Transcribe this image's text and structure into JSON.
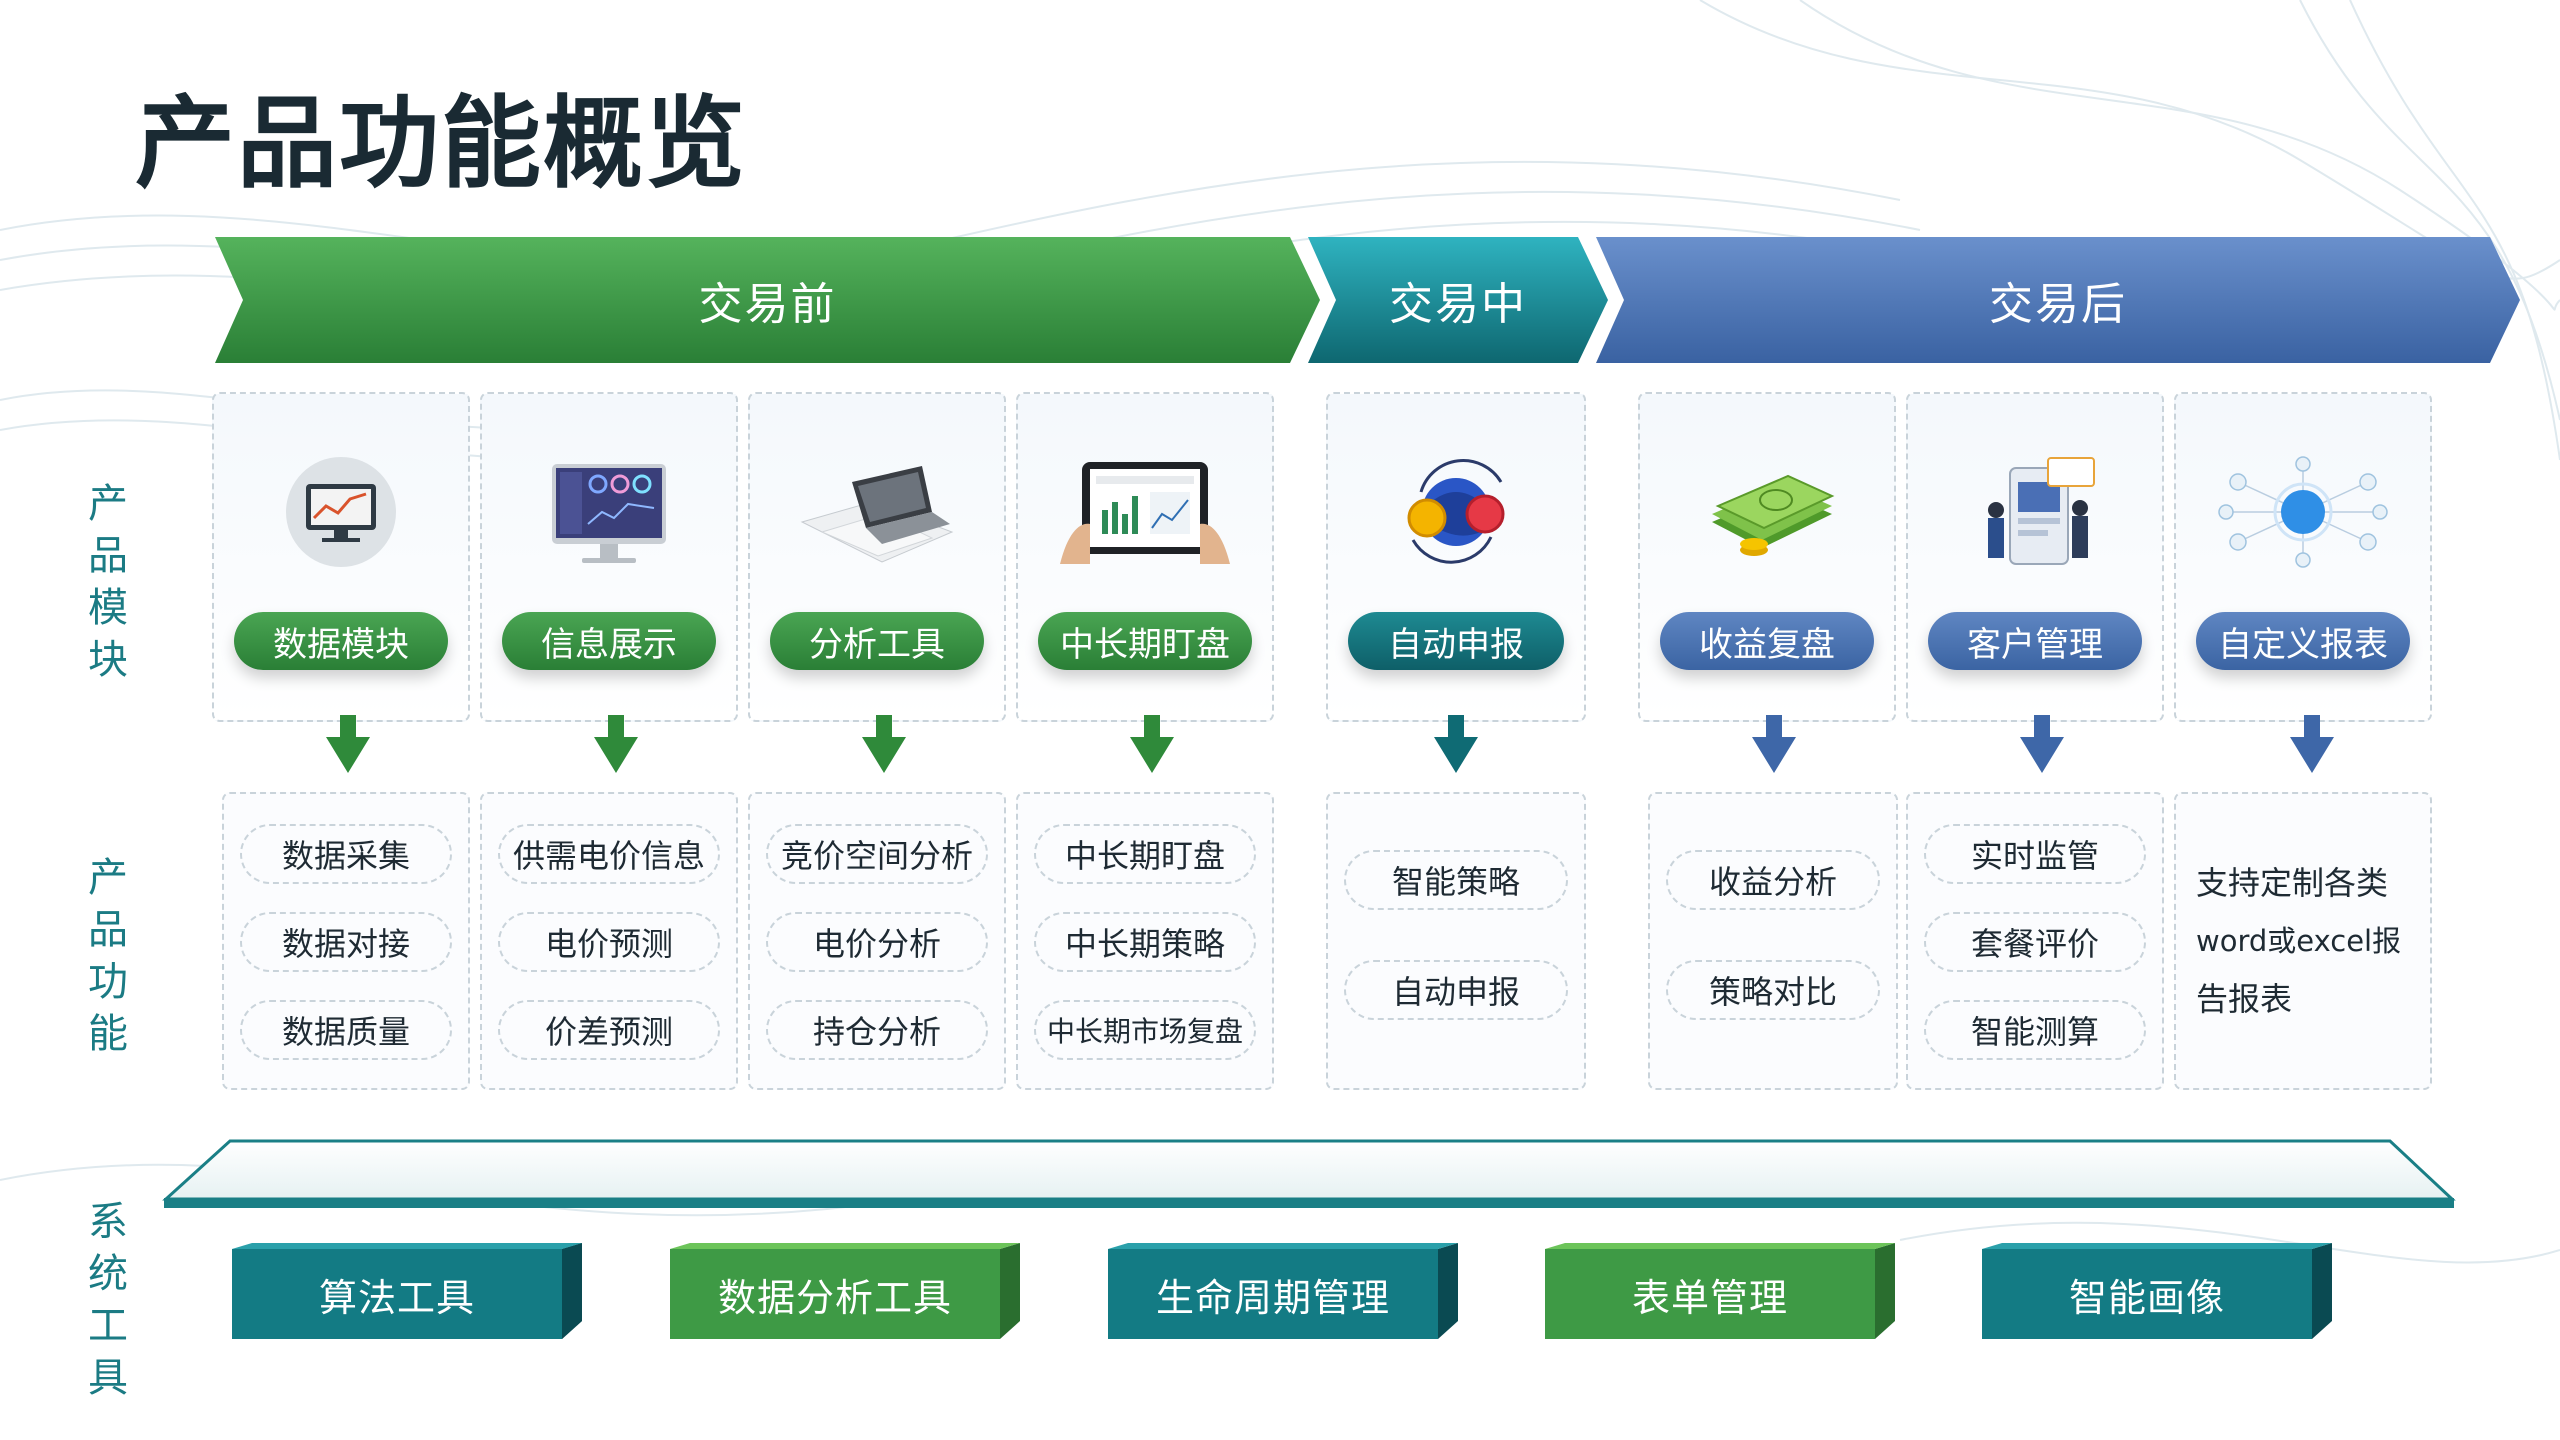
{
  "title": "产品功能概览",
  "side_labels": {
    "modules": "产品模块",
    "functions": "产品功能",
    "tools": "系统工具"
  },
  "phases": [
    {
      "label": "交易前",
      "color": "#3a9a44"
    },
    {
      "label": "交易中",
      "color": "#17808a"
    },
    {
      "label": "交易后",
      "color": "#4d77b8"
    }
  ],
  "modules": [
    {
      "label": "数据模块",
      "icon": "monitor-chart-icon",
      "style": "green",
      "functions": [
        "数据采集",
        "数据对接",
        "数据质量"
      ]
    },
    {
      "label": "信息展示",
      "icon": "dashboard-screen-icon",
      "style": "green",
      "functions": [
        "供需电价信息",
        "电价预测",
        "价差预测"
      ]
    },
    {
      "label": "分析工具",
      "icon": "laptop-documents-icon",
      "style": "green",
      "functions": [
        "竞价空间分析",
        "电价分析",
        "持仓分析"
      ]
    },
    {
      "label": "中长期盯盘",
      "icon": "tablet-hands-icon",
      "style": "green",
      "functions": [
        "中长期盯盘",
        "中长期策略",
        "中长期市场复盘"
      ]
    },
    {
      "label": "自动申报",
      "icon": "globe-exchange-icon",
      "style": "teal",
      "functions": [
        "智能策略",
        "自动申报"
      ]
    },
    {
      "label": "收益复盘",
      "icon": "money-stack-icon",
      "style": "blue",
      "functions": [
        "收益分析",
        "策略对比"
      ]
    },
    {
      "label": "客户管理",
      "icon": "people-report-icon",
      "style": "blue",
      "functions": [
        "实时监管",
        "套餐评价",
        "智能测算"
      ]
    },
    {
      "label": "自定义报表",
      "icon": "network-hub-icon",
      "style": "blue",
      "text": [
        "支持定制各类",
        "word或excel报",
        "告报表"
      ]
    }
  ],
  "tools": [
    {
      "label": "算法工具",
      "color": "teal"
    },
    {
      "label": "数据分析工具",
      "color": "green"
    },
    {
      "label": "生命周期管理",
      "color": "teal"
    },
    {
      "label": "表单管理",
      "color": "green"
    },
    {
      "label": "智能画像",
      "color": "teal"
    }
  ]
}
